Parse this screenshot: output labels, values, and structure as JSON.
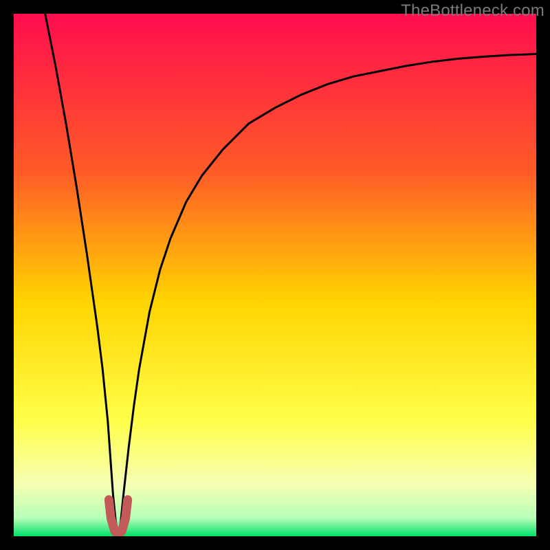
{
  "watermark": "TheBottleneck.com",
  "chart_data": {
    "type": "line",
    "title": "",
    "xlabel": "",
    "ylabel": "",
    "xlim": [
      0,
      100
    ],
    "ylim": [
      0,
      100
    ],
    "grid": false,
    "legend": false,
    "gradient_stops": [
      {
        "offset": 0.0,
        "color": "#ff0d4e"
      },
      {
        "offset": 0.3,
        "color": "#ff5a27"
      },
      {
        "offset": 0.55,
        "color": "#ffd400"
      },
      {
        "offset": 0.78,
        "color": "#ffff4a"
      },
      {
        "offset": 0.9,
        "color": "#f6ffb3"
      },
      {
        "offset": 0.965,
        "color": "#b7ffb7"
      },
      {
        "offset": 1.0,
        "color": "#00e06a"
      }
    ],
    "series": [
      {
        "name": "bottleneck-curve",
        "stroke": "#000000",
        "x": [
          6,
          8,
          10,
          12,
          14,
          15,
          16,
          17,
          18,
          18.5,
          19,
          19.5,
          20,
          20.5,
          21,
          22,
          23,
          24,
          26,
          28,
          30,
          33,
          36,
          40,
          45,
          50,
          55,
          60,
          65,
          70,
          75,
          80,
          85,
          90,
          95,
          100
        ],
        "y": [
          100,
          90,
          79,
          67,
          54,
          47,
          40,
          32,
          22,
          15,
          8,
          3,
          0,
          3,
          8,
          17,
          25,
          32,
          43,
          51,
          57,
          64,
          69,
          74,
          79,
          82,
          84.5,
          86.5,
          88,
          89,
          90,
          90.8,
          91.4,
          91.8,
          92.1,
          92.3
        ]
      }
    ],
    "markers": [
      {
        "name": "optimum-marker",
        "shape": "u",
        "stroke": "#c25a5a",
        "stroke_width": 13,
        "points": [
          {
            "x": 18.2,
            "y": 7.0
          },
          {
            "x": 18.6,
            "y": 3.5
          },
          {
            "x": 19.3,
            "y": 1.0
          },
          {
            "x": 20.0,
            "y": 0.4
          },
          {
            "x": 20.7,
            "y": 1.0
          },
          {
            "x": 21.4,
            "y": 3.5
          },
          {
            "x": 21.8,
            "y": 7.0
          }
        ]
      }
    ]
  }
}
